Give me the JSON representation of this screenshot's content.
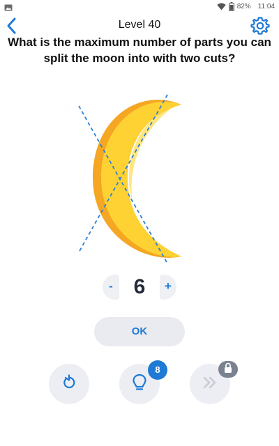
{
  "status_bar": {
    "battery_percent": "82%",
    "time": "11:04",
    "icons": [
      "image-icon",
      "wifi-icon",
      "battery-icon"
    ]
  },
  "header": {
    "level_title": "Level 40",
    "question": "What is the maximum number of parts you can split the moon into with two cuts?"
  },
  "answer": {
    "minus_label": "-",
    "value": "6",
    "plus_label": "+"
  },
  "ok_label": "OK",
  "hint_count": "8",
  "colors": {
    "accent": "#1f7ad6",
    "moon": "#ffd233",
    "moon_shadow": "#f5a623",
    "button_bg": "#eceef3"
  }
}
